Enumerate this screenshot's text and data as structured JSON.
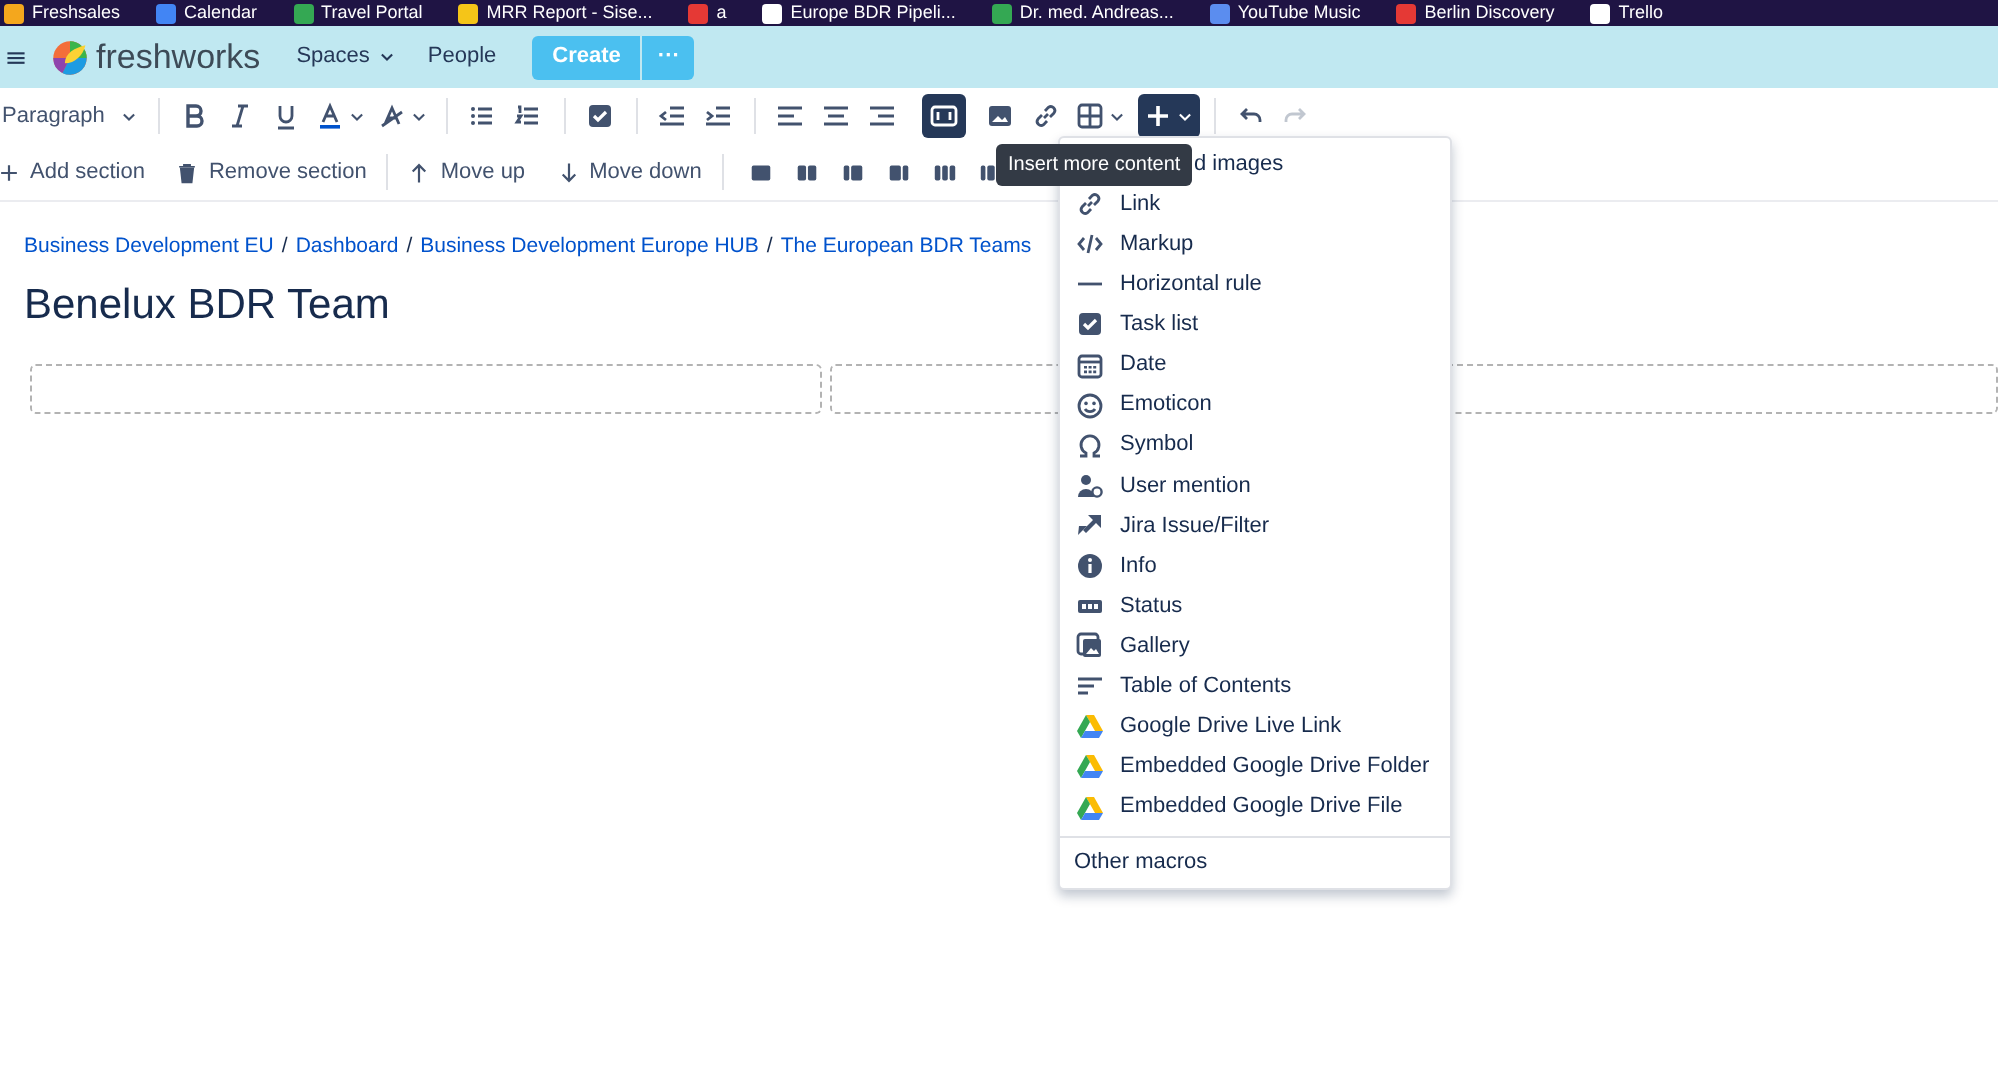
{
  "bookmarks": [
    "Freshsales",
    "Calendar",
    "Travel Portal",
    "MRR Report - Sise...",
    "a",
    "Europe BDR Pipeli...",
    "Dr. med. Andreas...",
    "YouTube Music",
    "Berlin Discovery",
    "Trello"
  ],
  "header": {
    "logo_text": "freshworks",
    "nav": [
      "Spaces",
      "People"
    ],
    "create_button": "Create",
    "more_button": "···"
  },
  "toolbar": {
    "style_dropdown": "Paragraph",
    "page_layout_selected": true,
    "insert_expanded": true,
    "section_actions": [
      "Add section",
      "Remove section",
      "Move up",
      "Move down"
    ]
  },
  "tooltip": "Insert more content",
  "breadcrumbs": [
    {
      "label": "Business Development EU",
      "separator": "/"
    },
    {
      "label": "Dashboard",
      "separator": "/"
    },
    {
      "label": "Business Development Europe HUB",
      "separator": "/"
    },
    {
      "label": "The European BDR Teams"
    }
  ],
  "page_title": "Benelux BDR Team",
  "insert_menu": {
    "items": [
      "d images",
      "Link",
      "Markup",
      "Horizontal rule",
      "Task list",
      "Date",
      "Emoticon",
      "Symbol",
      "User mention",
      "Jira Issue/Filter",
      "Info",
      "Status",
      "Gallery",
      "Table of Contents",
      "Google Drive Live Link",
      "Embedded Google Drive Folder",
      "Embedded Google Drive File"
    ],
    "footer": "Other macros"
  }
}
